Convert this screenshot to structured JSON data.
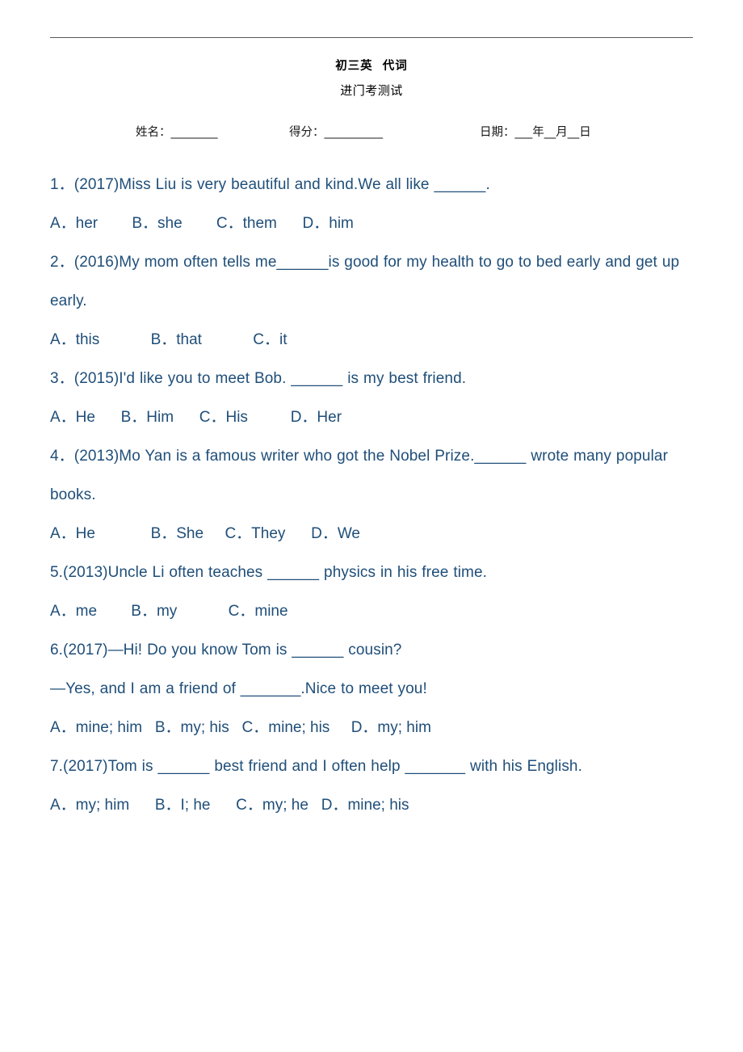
{
  "document": {
    "title_line1": "初三英  代词",
    "title_line2": "进门考测试",
    "meta": {
      "name_label": "姓名：________",
      "score_label": "得分：__________",
      "date_label": "日期：___年__月__日"
    },
    "text_color": "#1f4e79",
    "rule_color": "#58575c"
  },
  "questions": [
    {
      "number": "1．",
      "stem": "1．(2017)Miss Liu is very beautiful and kind.We all like ______.",
      "options": "A．her        B．she        C．them      D．him"
    },
    {
      "number": "2．",
      "stem": "2．(2016)My mom often tells me______is good for my health to go to bed early and get up early.",
      "options": "A．this            B．that            C．it"
    },
    {
      "number": "3．",
      "stem": "3．(2015)I'd like you to meet Bob. ______ is my best friend.",
      "options": "A．He      B．Him      C．His          D．Her"
    },
    {
      "number": "4．",
      "stem": "4．(2013)Mo Yan is a famous writer who got the Nobel Prize.______ wrote many popular books.",
      "options": "A．He             B．She     C．They      D．We"
    },
    {
      "number": "5.",
      "stem": "5.(2013)Uncle Li often teaches ______ physics in his free time.",
      "options": "A．me        B．my            C．mine"
    },
    {
      "number": "6.",
      "stem": "6.(2017)—Hi! Do you know Tom is ______ cousin?",
      "stem2": "—Yes, and I am a friend of _______.Nice to meet you!",
      "options": "A．mine; him   B．my; his   C．mine; his     D．my; him"
    },
    {
      "number": "7.",
      "stem": "7.(2017)Tom is ______ best friend and I often help _______ with his English.",
      "options": "A．my; him      B．I; he      C．my; he   D．mine; his"
    }
  ]
}
